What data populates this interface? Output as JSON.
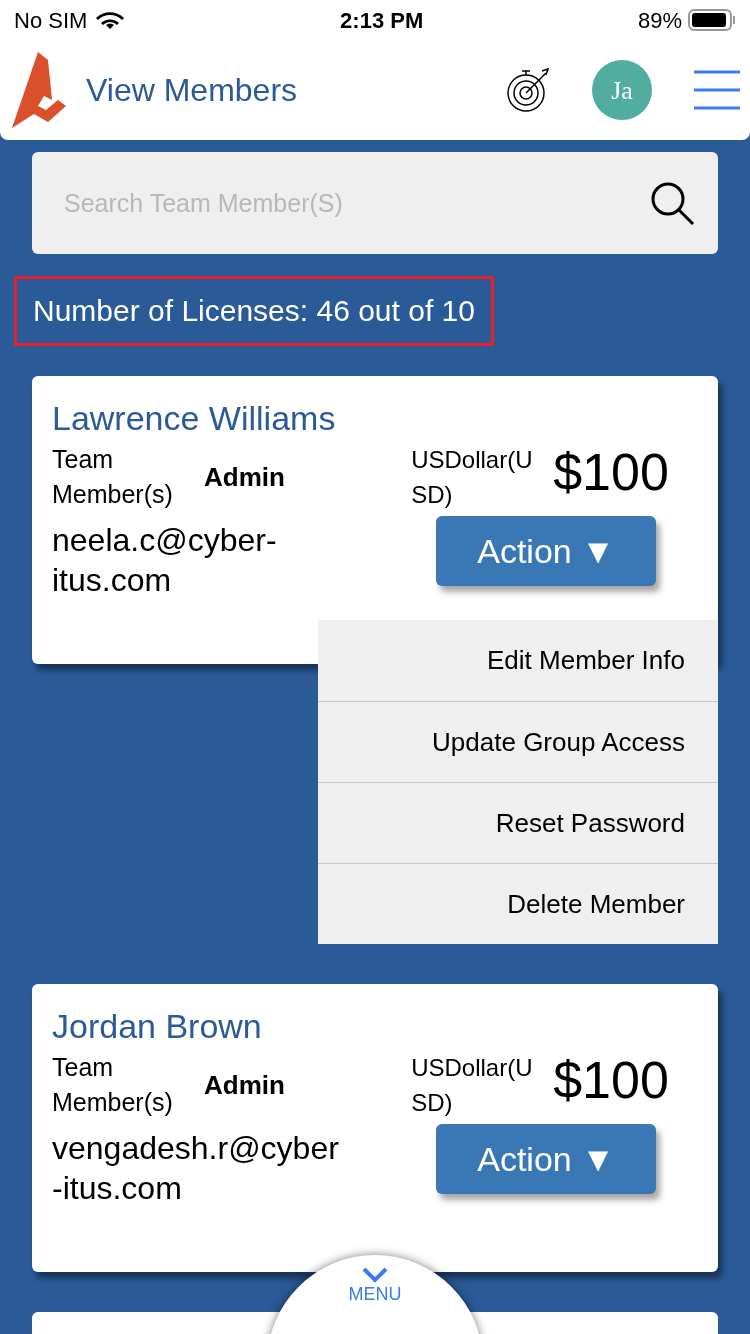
{
  "status_bar": {
    "carrier": "No SIM",
    "time": "2:13 PM",
    "battery": "89%"
  },
  "header": {
    "title": "View Members",
    "avatar": "Ja"
  },
  "search": {
    "placeholder": "Search Team Member(S)"
  },
  "licenses": "Number of Licenses: 46 out of 10",
  "members": [
    {
      "name": "Lawrence Williams",
      "role_label": "Team Member(s)",
      "role": "Admin",
      "email": "neela.c@cyber-itus.com",
      "currency": "USDollar(USD)",
      "amount": "$100",
      "action": "Action ▼",
      "menu": [
        "Edit Member Info",
        "Update Group Access",
        "Reset Password",
        "Delete Member"
      ]
    },
    {
      "name": "Jordan Brown",
      "role_label": "Team Member(s)",
      "role": "Admin",
      "email": "vengadesh.r@cyber-itus.com",
      "currency": "USDollar(USD)",
      "amount": "$100",
      "action": "Action ▼"
    }
  ],
  "bottom_menu": "MENU"
}
